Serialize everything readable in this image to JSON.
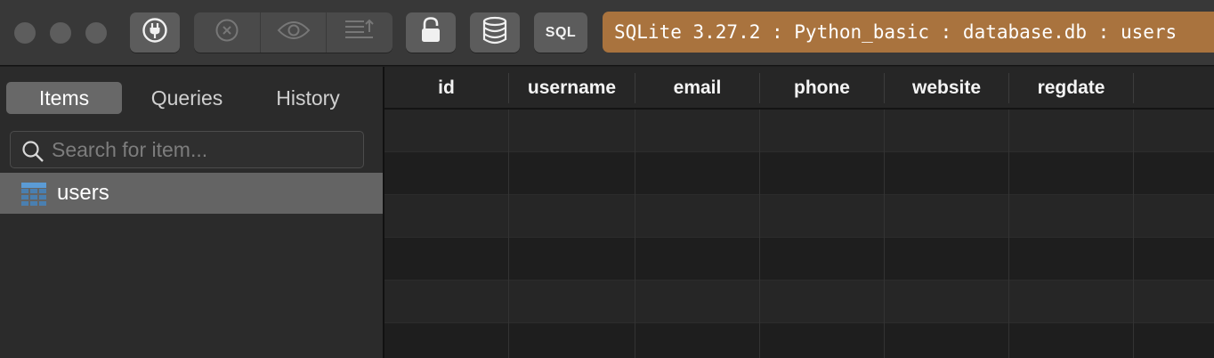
{
  "toolbar": {
    "sql_label": "SQL",
    "connection": "SQLite 3.27.2 : Python_basic : database.db : users",
    "connection_color": "#a9733e",
    "icons": [
      "plug-icon",
      "close-circle-icon",
      "eye-icon",
      "text-align-icon",
      "unlock-icon",
      "database-icon"
    ]
  },
  "sidebar": {
    "tabs": [
      {
        "label": "Items",
        "active": true
      },
      {
        "label": "Queries",
        "active": false
      },
      {
        "label": "History",
        "active": false
      }
    ],
    "search": {
      "placeholder": "Search for item...",
      "value": ""
    },
    "items": [
      {
        "label": "users",
        "icon": "table-icon",
        "selected": true
      }
    ]
  },
  "grid": {
    "columns": [
      "id",
      "username",
      "email",
      "phone",
      "website",
      "regdate"
    ],
    "rows": []
  }
}
